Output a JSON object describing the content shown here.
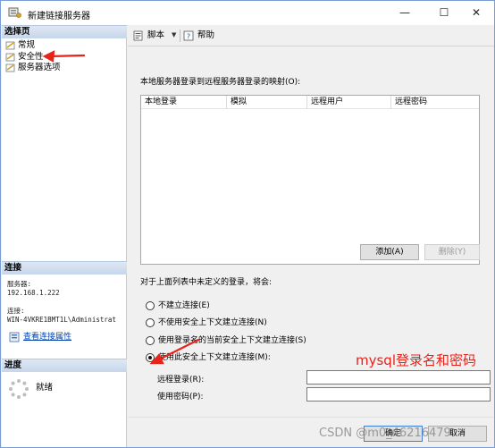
{
  "window": {
    "title": "新建链接服务器",
    "controls": {
      "minimize": "—",
      "maximize": "☐",
      "close": "✕"
    }
  },
  "left": {
    "select_page_header": "选择页",
    "pages": [
      {
        "label": "常规",
        "icon": "page-icon"
      },
      {
        "label": "安全性",
        "icon": "page-icon"
      },
      {
        "label": "服务器选项",
        "icon": "page-icon"
      }
    ],
    "connection_header": "连接",
    "server_label": "服务器:",
    "server_value": "192.168.1.222",
    "connection_label": "连接:",
    "connection_value": "WIN-4VKRE1BMT1L\\Administrat",
    "view_props_link": "查看连接属性",
    "progress_header": "进度",
    "progress_status": "就绪"
  },
  "toolbar": {
    "script_label": "脚本",
    "help_label": "帮助"
  },
  "main": {
    "mapping_label": "本地服务器登录到远程服务器登录的映射(O):",
    "columns": [
      "本地登录",
      "模拟",
      "远程用户",
      "远程密码"
    ],
    "add_button": "添加(A)",
    "remove_button": "删除(Y)",
    "undefined_label": "对于上面列表中未定义的登录，将会:",
    "options": [
      {
        "label": "不建立连接(E)",
        "checked": false
      },
      {
        "label": "不使用安全上下文建立连接(N)",
        "checked": false
      },
      {
        "label": "使用登录名的当前安全上下文建立连接(S)",
        "checked": false
      },
      {
        "label": "使用此安全上下文建立连接(M):",
        "checked": true
      }
    ],
    "remote_login_label": "远程登录(R):",
    "remote_login_value": "",
    "password_label": "使用密码(P):",
    "password_value": ""
  },
  "footer": {
    "ok_button": "确定",
    "cancel_button": "取消"
  },
  "annotation": {
    "text": "mysql登录名和密码",
    "color": "#e8231a"
  },
  "watermark": "CSDN @m0_46216479"
}
